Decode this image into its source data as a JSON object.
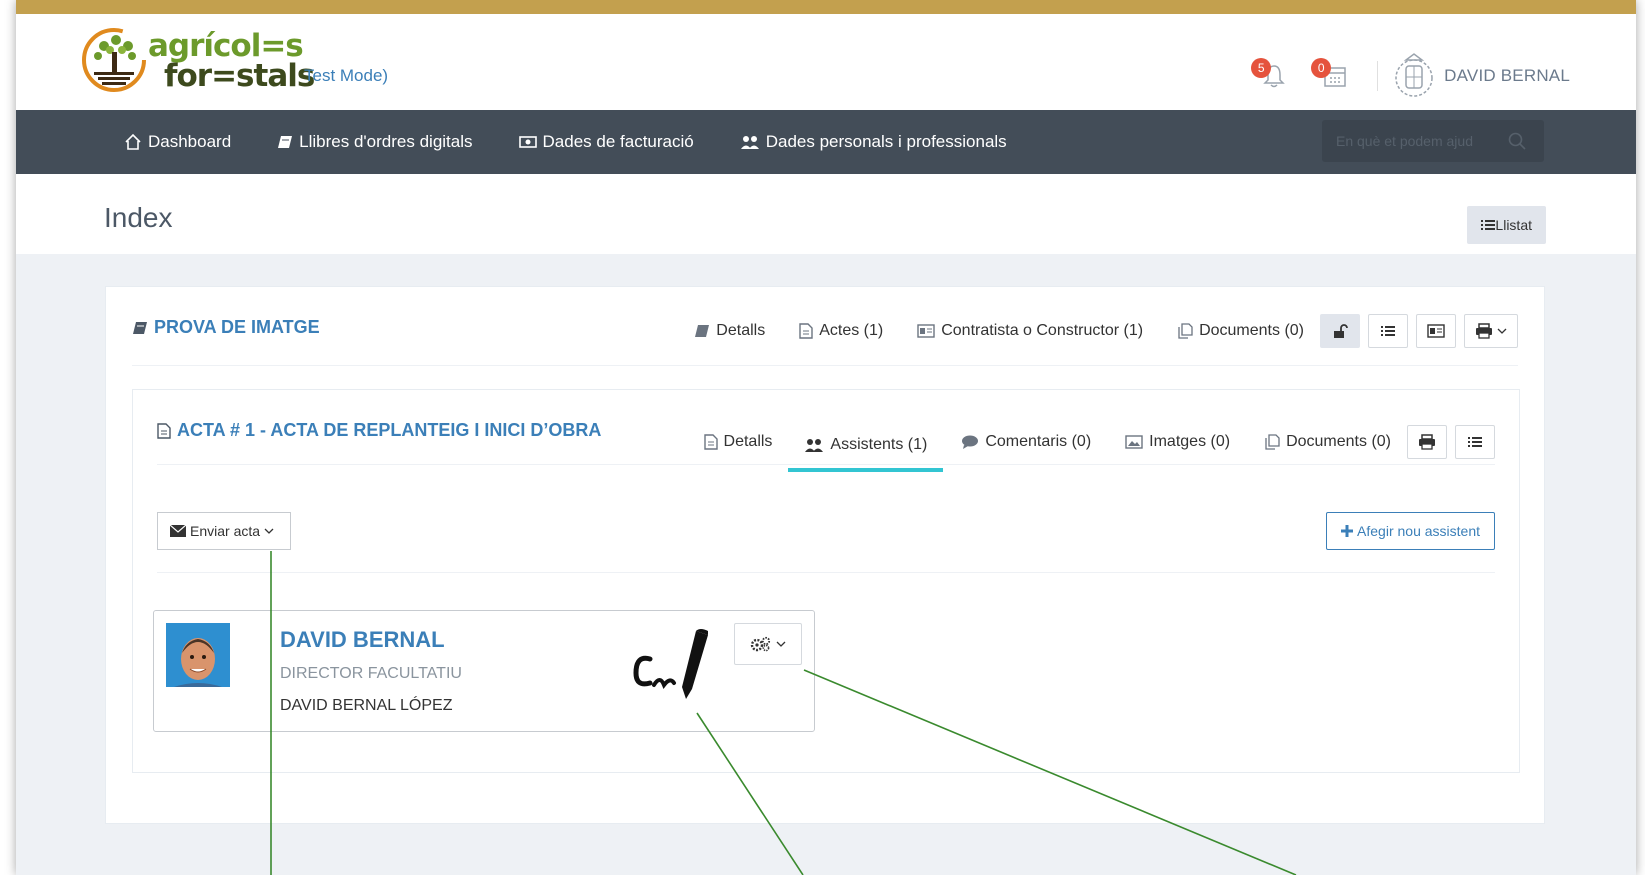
{
  "header": {
    "logo": {
      "line1": "agrícol=s",
      "line2": "for=stals"
    },
    "test_mode": "Test Mode)",
    "notifications": {
      "bell_count": "5",
      "calendar_count": "0"
    },
    "user_name": "DAVID BERNAL"
  },
  "nav": {
    "items": [
      {
        "label": "Dashboard",
        "icon": "home-icon"
      },
      {
        "label": "Llibres d'ordres digitals",
        "icon": "book-icon"
      },
      {
        "label": "Dades de facturació",
        "icon": "money-icon"
      },
      {
        "label": "Dades personals i professionals",
        "icon": "users-icon"
      }
    ],
    "search_placeholder": "En què et podem ajud"
  },
  "page": {
    "title": "Index",
    "list_button": "Llistat"
  },
  "book": {
    "title": "PROVA DE IMATGE",
    "tabs": [
      {
        "label": "Detalls",
        "icon": "book-icon"
      },
      {
        "label": "Actes (1)",
        "icon": "file-icon"
      },
      {
        "label": "Contratista o Constructor (1)",
        "icon": "id-card-icon"
      },
      {
        "label": "Documents (0)",
        "icon": "files-icon"
      }
    ]
  },
  "acta": {
    "title": "ACTA # 1 - ACTA DE REPLANTEIG I INICI D’OBRA",
    "tabs": [
      {
        "label": "Detalls",
        "icon": "file-icon"
      },
      {
        "label": "Assistents (1)",
        "icon": "users-icon",
        "active": true
      },
      {
        "label": "Comentaris (0)",
        "icon": "comment-icon"
      },
      {
        "label": "Imatges (0)",
        "icon": "image-icon"
      },
      {
        "label": "Documents (0)",
        "icon": "files-icon"
      }
    ],
    "send_button": "Enviar acta",
    "add_button": "Afegir nou assistent",
    "assistant": {
      "name": "DAVID BERNAL",
      "role": "DIRECTOR FACULTATIU",
      "full_name": "DAVID BERNAL LÓPEZ"
    }
  },
  "colors": {
    "gold_bar": "#c3a04e",
    "navbar": "#434d58",
    "link_blue": "#3b7fb8",
    "active_tab": "#32c5d2",
    "badge_red": "#e5533d",
    "annotation_green": "#3a8a2e"
  }
}
